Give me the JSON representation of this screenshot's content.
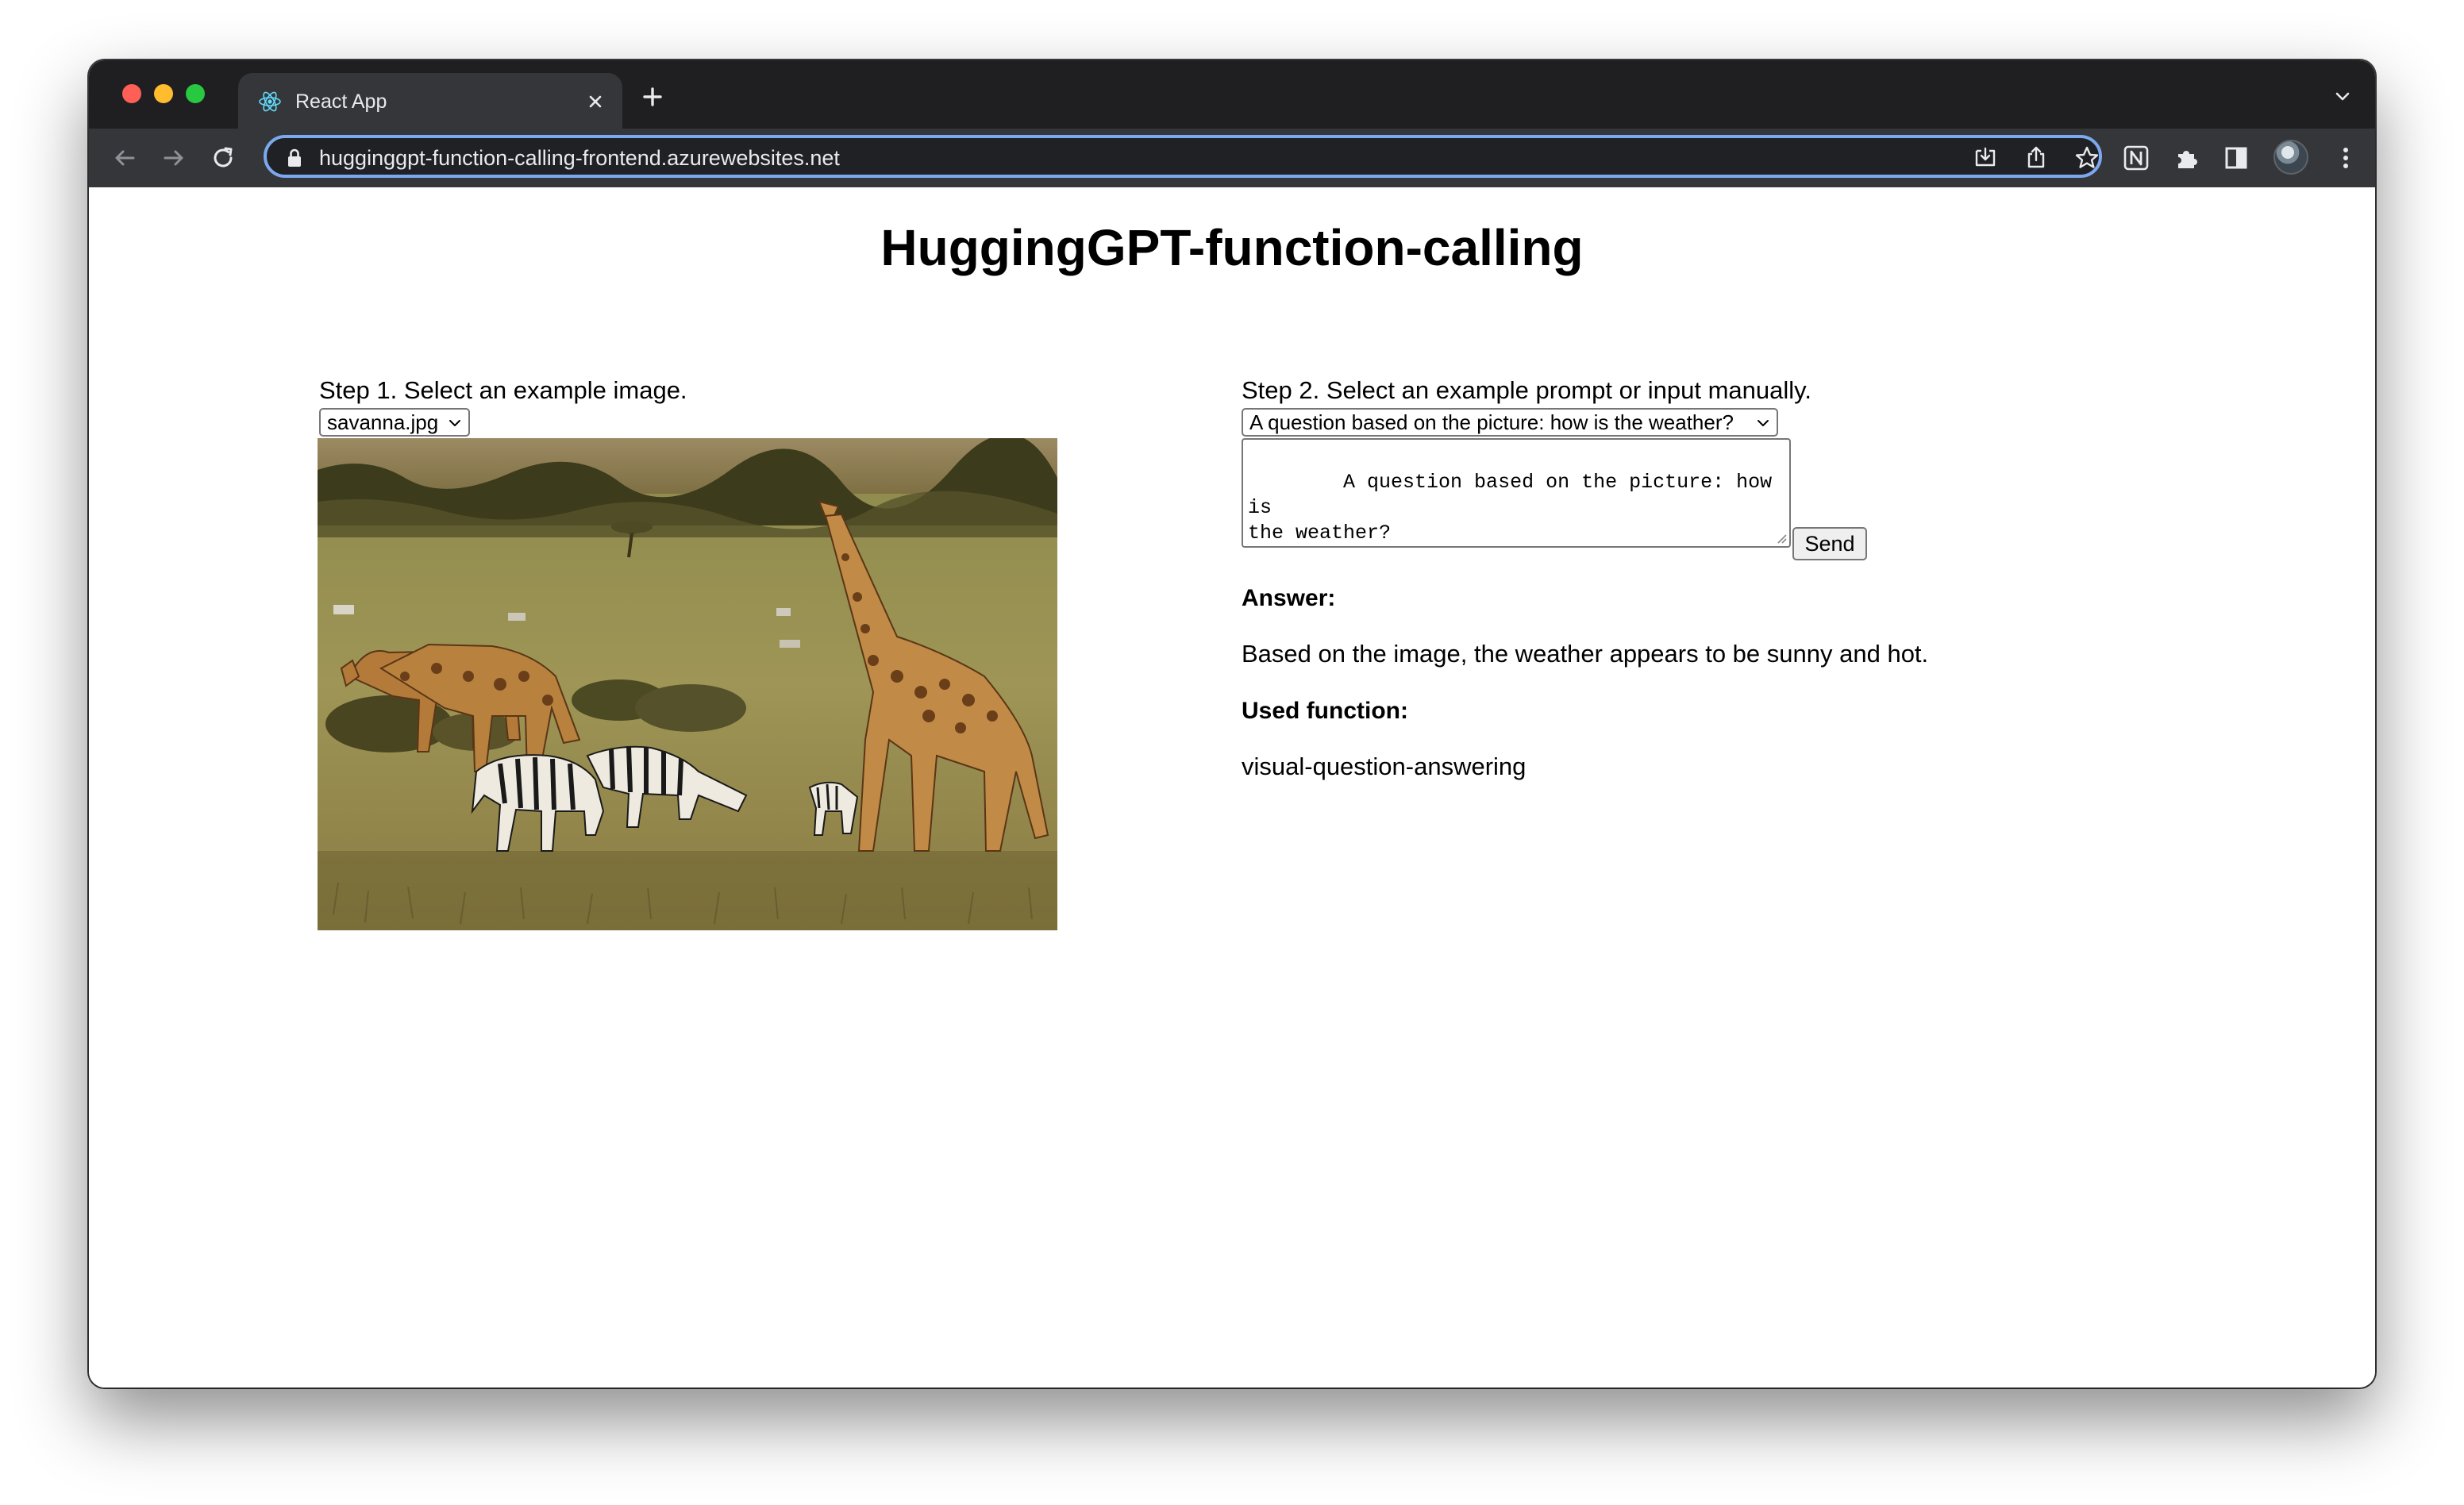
{
  "browser": {
    "tab_title": "React App",
    "tab_close_icon": "close-icon",
    "new_tab_label": "+",
    "url": "hugginggpt-function-calling-frontend.azurewebsites.net",
    "accent_color": "#7ca8f0"
  },
  "page": {
    "title": "HuggingGPT-function-calling",
    "step1": {
      "label": "Step 1. Select an example image.",
      "selected_image": "savanna.jpg"
    },
    "step2": {
      "label": "Step 2. Select an example prompt or input manually.",
      "selected_prompt": "A question based on the picture: how is the weather?",
      "prompt_text": "A question based on the picture: how is\nthe weather?",
      "send_label": "Send"
    },
    "answer": {
      "heading": "Answer:",
      "text": "Based on the image, the weather appears to be sunny and hot."
    },
    "used_function": {
      "heading": "Used function:",
      "text": "visual-question-answering"
    }
  }
}
